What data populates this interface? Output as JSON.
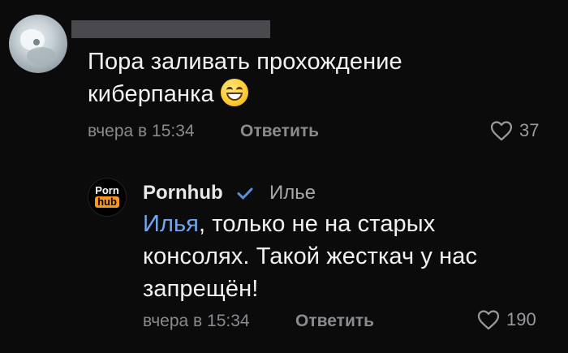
{
  "comment1": {
    "text": "Пора заливать прохождение киберпанка",
    "emoji": "smiling-face-emoji",
    "time": "вчера в 15:34",
    "reply_label": "Ответить",
    "likes": "37"
  },
  "comment2": {
    "author": "Pornhub",
    "reply_to": "Илье",
    "avatar_text": {
      "top": "Porn",
      "bottom": "hub"
    },
    "mention": "Илья",
    "text": ", только не на старых консолях. Такой жесткач у нас запрещён!",
    "time": "вчера в 15:34",
    "reply_label": "Ответить",
    "likes": "190"
  },
  "colors": {
    "background": "#0b0b0c",
    "mention": "#71a7f0",
    "muted": "#8b8b8f",
    "brand_orange": "#f7971e",
    "verified": "#5b8fd6"
  }
}
